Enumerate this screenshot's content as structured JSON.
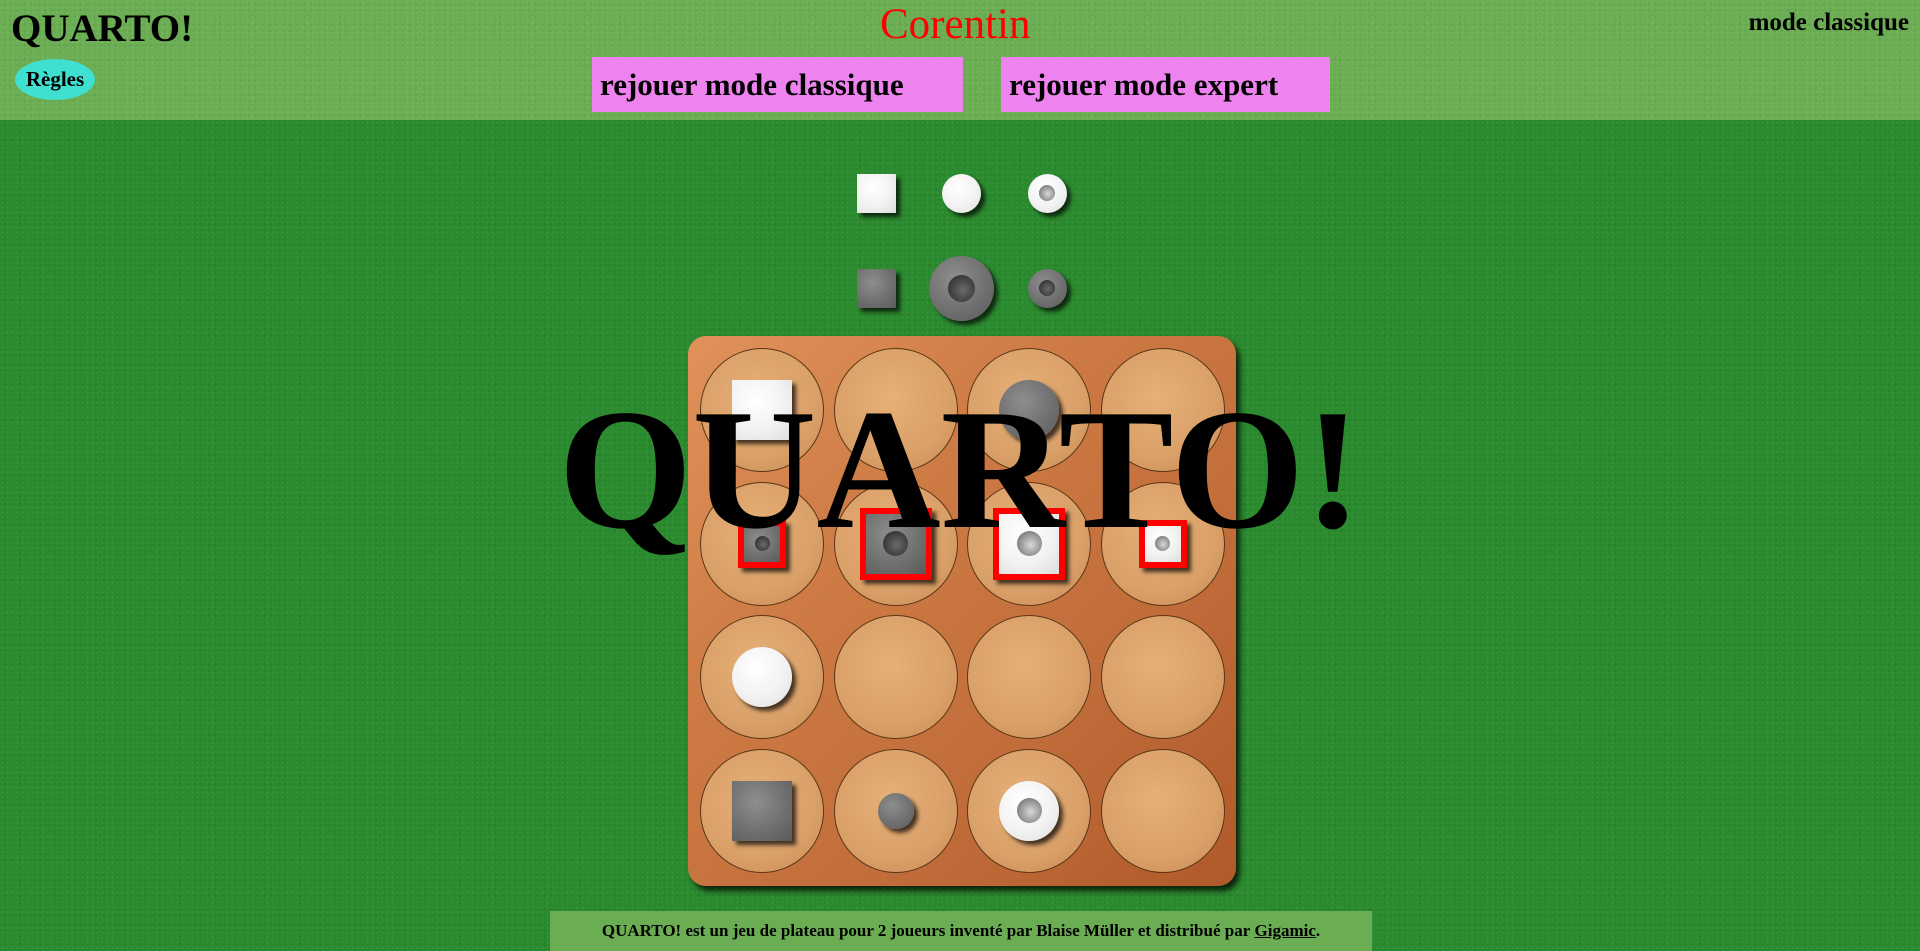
{
  "header": {
    "logo": "QUARTO!",
    "rules_label": "Règles",
    "player_name": "Corentin",
    "mode": "mode classique",
    "replay_classic": "rejouer mode classique",
    "replay_expert": "rejouer mode expert"
  },
  "available_pieces": [
    {
      "id": "avail-1",
      "color": "light",
      "shape": "square",
      "size": "small",
      "hollow": false
    },
    {
      "id": "avail-2",
      "color": "light",
      "shape": "round",
      "size": "small",
      "hollow": false
    },
    {
      "id": "avail-3",
      "color": "light",
      "shape": "round",
      "size": "small",
      "hollow": true
    },
    {
      "id": "avail-4",
      "color": "dark",
      "shape": "square",
      "size": "small",
      "hollow": false
    },
    {
      "id": "avail-5",
      "color": "dark",
      "shape": "round",
      "size": "tall",
      "hollow": true
    },
    {
      "id": "avail-6",
      "color": "dark",
      "shape": "round",
      "size": "small",
      "hollow": true
    }
  ],
  "board": {
    "rows": 4,
    "cols": 4,
    "placed": [
      {
        "row": 0,
        "col": 0,
        "color": "light",
        "shape": "square",
        "size": "tall",
        "hollow": false,
        "winning": false
      },
      {
        "row": 0,
        "col": 2,
        "color": "dark",
        "shape": "round",
        "size": "tall",
        "hollow": false,
        "winning": false
      },
      {
        "row": 1,
        "col": 0,
        "color": "dark",
        "shape": "square",
        "size": "small",
        "hollow": true,
        "winning": true
      },
      {
        "row": 1,
        "col": 1,
        "color": "dark",
        "shape": "square",
        "size": "tall",
        "hollow": true,
        "winning": true
      },
      {
        "row": 1,
        "col": 2,
        "color": "light",
        "shape": "square",
        "size": "tall",
        "hollow": true,
        "winning": true
      },
      {
        "row": 1,
        "col": 3,
        "color": "light",
        "shape": "square",
        "size": "small",
        "hollow": true,
        "winning": true
      },
      {
        "row": 2,
        "col": 0,
        "color": "light",
        "shape": "round",
        "size": "tall",
        "hollow": false,
        "winning": false
      },
      {
        "row": 3,
        "col": 0,
        "color": "dark",
        "shape": "square",
        "size": "tall",
        "hollow": false,
        "winning": false
      },
      {
        "row": 3,
        "col": 1,
        "color": "dark",
        "shape": "round",
        "size": "small",
        "hollow": false,
        "winning": false
      },
      {
        "row": 3,
        "col": 2,
        "color": "light",
        "shape": "round",
        "size": "tall",
        "hollow": true,
        "winning": false
      }
    ]
  },
  "win_banner": "QUARTO!",
  "footer": {
    "text": "QUARTO! est un jeu de plateau pour 2 joueurs inventé par Blaise Müller et distribué par ",
    "link": "Gigamic",
    "suffix": "."
  },
  "colors": {
    "felt": "#2a8a2e",
    "header": "#6aad52",
    "player_name": "#ff0000",
    "replay_button": "#ee82ee",
    "rules_button": "#40e0d0",
    "highlight": "#ff0000"
  }
}
